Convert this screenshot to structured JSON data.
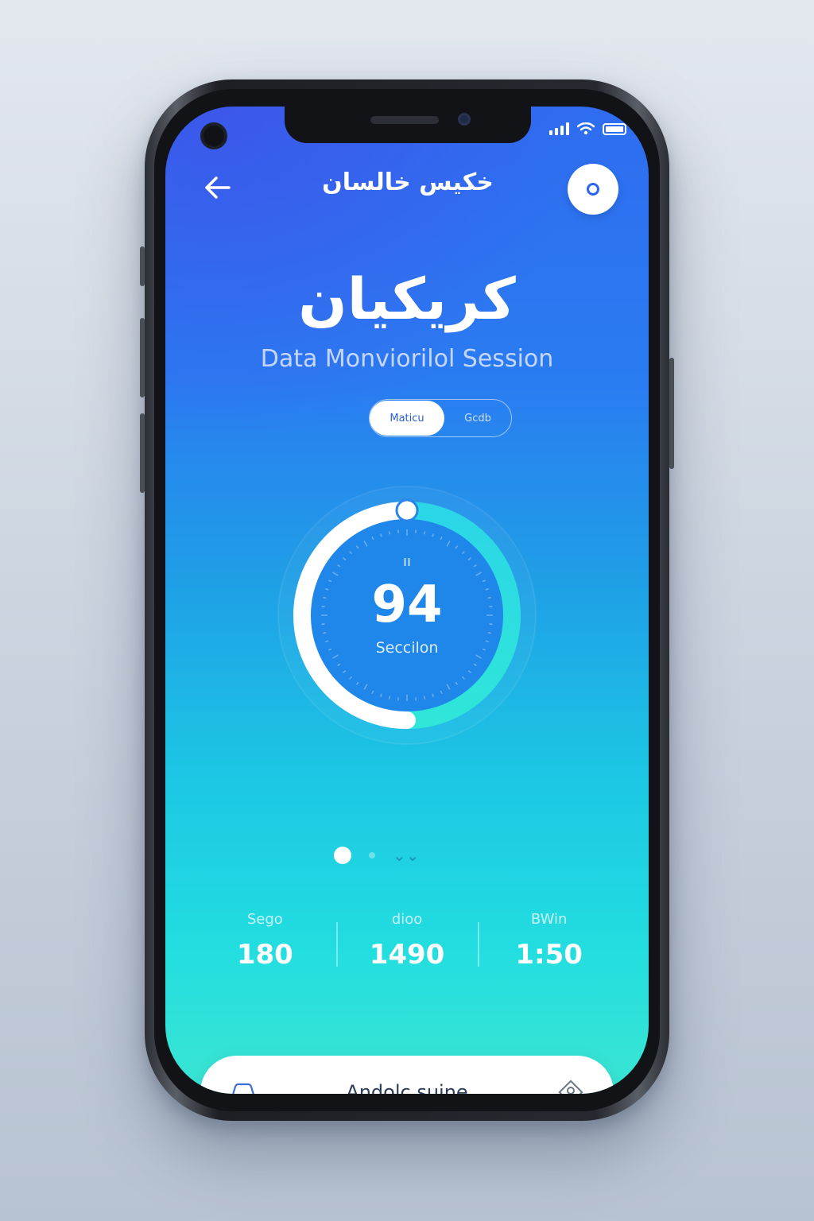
{
  "header": {
    "title": "خكيس خالسان"
  },
  "main": {
    "headline": "كريكيان",
    "subtitle": "Data Monviorilol Session",
    "toggle": {
      "option_active": "Maticu",
      "option_inactive": "Gcdb"
    }
  },
  "gauge": {
    "top_label": "ıı",
    "value": "94",
    "label": "Seccilon",
    "progress_fraction": 0.5
  },
  "carousel": {
    "active_index": 0,
    "count": 3
  },
  "stats": [
    {
      "label": "Sego",
      "value": "180"
    },
    {
      "label": "dioo",
      "value": "1490"
    },
    {
      "label": "BWin",
      "value": "1:50"
    }
  ],
  "action": {
    "label": "Andolc suine"
  },
  "icons": {
    "back": "arrow-left-icon",
    "profile": "profile-ring-icon",
    "action_left": "car-icon",
    "action_right": "diamond-location-icon"
  },
  "colors": {
    "gradient_top": "#2f6cf0",
    "gradient_bottom": "#3be6d2",
    "gauge_accent": "#2fe0e0",
    "accent_blue": "#2b64f0"
  }
}
